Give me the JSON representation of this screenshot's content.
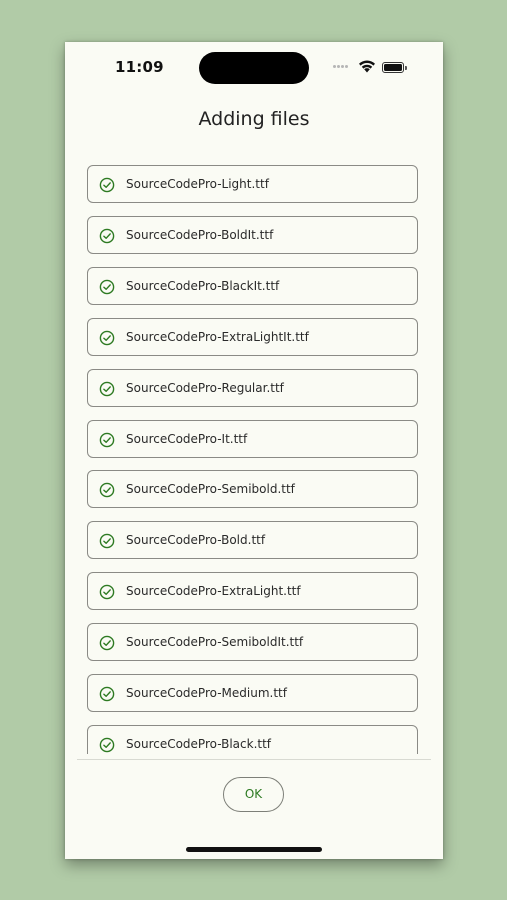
{
  "status_bar": {
    "time": "11:09"
  },
  "header": {
    "title": "Adding files"
  },
  "files": [
    {
      "name": "SourceCodePro-Light.ttf",
      "status": "done"
    },
    {
      "name": "SourceCodePro-BoldIt.ttf",
      "status": "done"
    },
    {
      "name": "SourceCodePro-BlackIt.ttf",
      "status": "done"
    },
    {
      "name": "SourceCodePro-ExtraLightIt.ttf",
      "status": "done"
    },
    {
      "name": "SourceCodePro-Regular.ttf",
      "status": "done"
    },
    {
      "name": "SourceCodePro-It.ttf",
      "status": "done"
    },
    {
      "name": "SourceCodePro-Semibold.ttf",
      "status": "done"
    },
    {
      "name": "SourceCodePro-Bold.ttf",
      "status": "done"
    },
    {
      "name": "SourceCodePro-ExtraLight.ttf",
      "status": "done"
    },
    {
      "name": "SourceCodePro-SemiboldIt.ttf",
      "status": "done"
    },
    {
      "name": "SourceCodePro-Medium.ttf",
      "status": "done"
    },
    {
      "name": "SourceCodePro-Black.ttf",
      "status": "done"
    }
  ],
  "footer": {
    "ok_label": "OK"
  },
  "colors": {
    "accent": "#2d7a22",
    "background": "#b1cba7",
    "surface": "#fafbf4"
  },
  "icons": {
    "file_status": "check-circle-icon"
  }
}
